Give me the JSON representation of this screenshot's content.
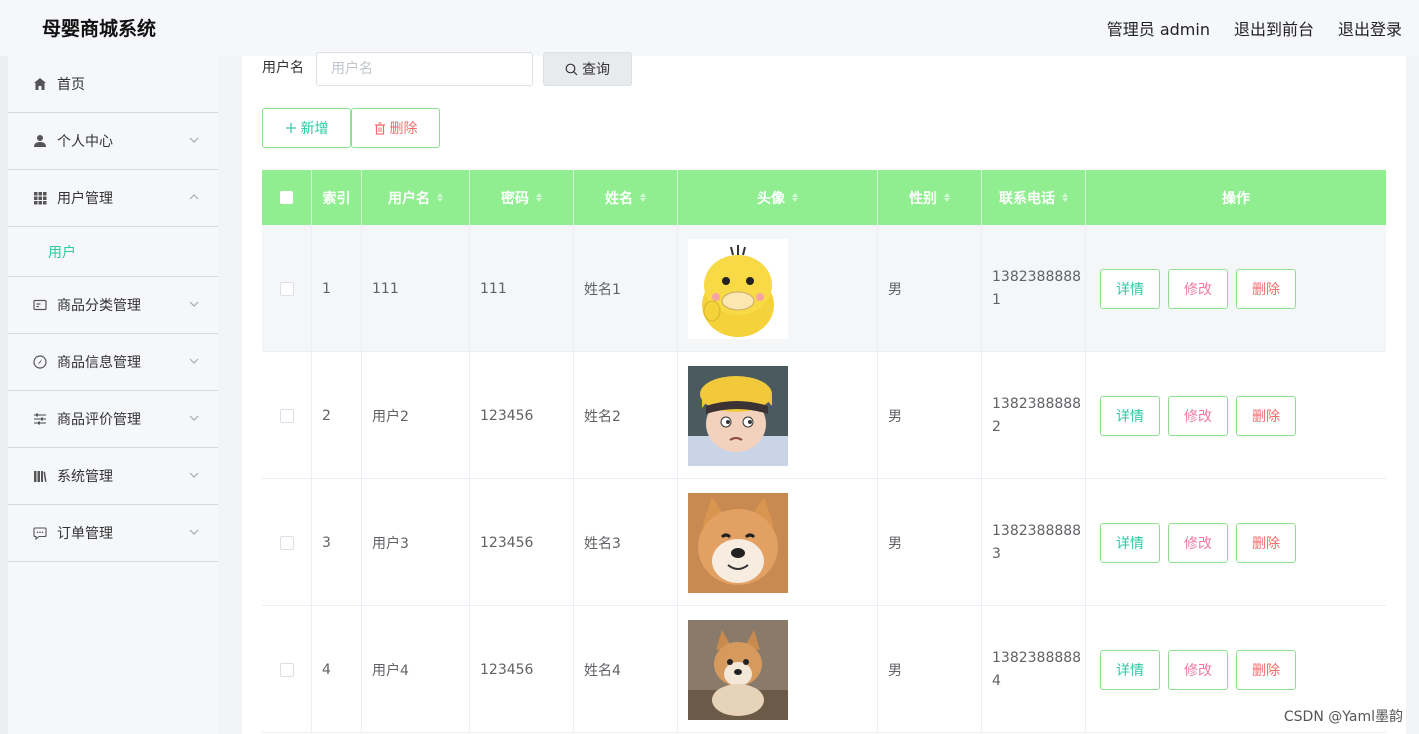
{
  "header": {
    "brand": "母婴商城系统",
    "admin_label": "管理员 admin",
    "front_label": "退出到前台",
    "logout_label": "退出登录"
  },
  "sidebar": {
    "items": [
      {
        "label": "首页",
        "icon": "home-icon"
      },
      {
        "label": "个人中心",
        "icon": "user-icon"
      },
      {
        "label": "用户管理",
        "icon": "grid-icon",
        "expanded": true,
        "sub": "用户"
      },
      {
        "label": "商品分类管理",
        "icon": "card-icon"
      },
      {
        "label": "商品信息管理",
        "icon": "compass-icon"
      },
      {
        "label": "商品评价管理",
        "icon": "sliders-icon"
      },
      {
        "label": "系统管理",
        "icon": "library-icon"
      },
      {
        "label": "订单管理",
        "icon": "chat-icon"
      }
    ]
  },
  "search": {
    "label": "用户名",
    "placeholder": "用户名",
    "query_label": "查询"
  },
  "actions": {
    "add_label": "新增",
    "delete_label": "删除"
  },
  "table": {
    "headers": {
      "index": "索引",
      "username": "用户名",
      "password": "密码",
      "name": "姓名",
      "avatar": "头像",
      "gender": "性别",
      "phone": "联系电话",
      "ops": "操作"
    },
    "rows": [
      {
        "index": "1",
        "username": "111",
        "password": "111",
        "name": "姓名1",
        "gender": "男",
        "phone1": "1382388888",
        "phone2": "1"
      },
      {
        "index": "2",
        "username": "用户2",
        "password": "123456",
        "name": "姓名2",
        "gender": "男",
        "phone1": "1382388888",
        "phone2": "2"
      },
      {
        "index": "3",
        "username": "用户3",
        "password": "123456",
        "name": "姓名3",
        "gender": "男",
        "phone1": "1382388888",
        "phone2": "3"
      },
      {
        "index": "4",
        "username": "用户4",
        "password": "123456",
        "name": "姓名4",
        "gender": "男",
        "phone1": "1382388888",
        "phone2": "4"
      }
    ],
    "row_actions": {
      "detail": "详情",
      "edit": "修改",
      "delete": "删除"
    }
  },
  "watermark": "CSDN @Yaml墨韵",
  "colors": {
    "accent_green": "#90ee90",
    "teal_text": "#2cc9a3",
    "danger": "#f56c6c",
    "edit_pink": "#f07aa5"
  }
}
